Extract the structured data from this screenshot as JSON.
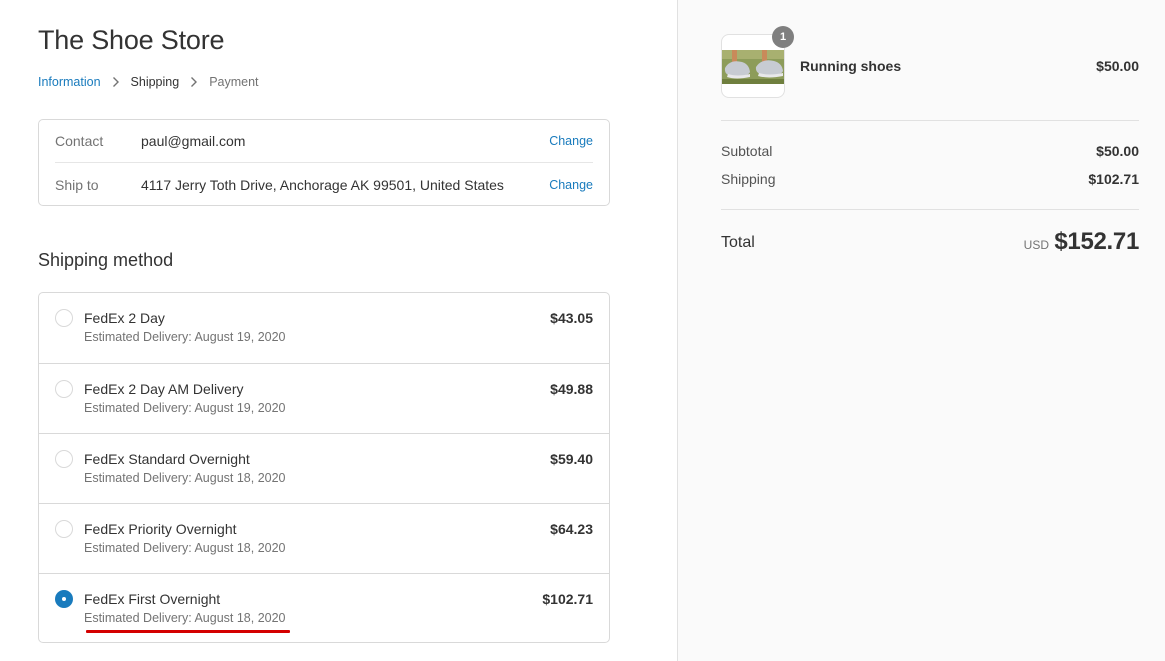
{
  "store": {
    "title": "The Shoe Store"
  },
  "breadcrumb": {
    "items": [
      {
        "label": "Information"
      },
      {
        "label": "Shipping"
      },
      {
        "label": "Payment"
      }
    ]
  },
  "review": {
    "contact": {
      "label": "Contact",
      "value": "paul@gmail.com",
      "change": "Change"
    },
    "ship_to": {
      "label": "Ship to",
      "value": "4117 Jerry Toth Drive, Anchorage AK 99501, United States",
      "change": "Change"
    }
  },
  "shipping": {
    "title": "Shipping method",
    "selected_index": 4,
    "methods": [
      {
        "name": "FedEx 2 Day",
        "eta": "Estimated Delivery: August 19, 2020",
        "price": "$43.05"
      },
      {
        "name": "FedEx 2 Day AM Delivery",
        "eta": "Estimated Delivery: August 19, 2020",
        "price": "$49.88"
      },
      {
        "name": "FedEx Standard Overnight",
        "eta": "Estimated Delivery: August 18, 2020",
        "price": "$59.40"
      },
      {
        "name": "FedEx Priority Overnight",
        "eta": "Estimated Delivery: August 18, 2020",
        "price": "$64.23"
      },
      {
        "name": "FedEx First Overnight",
        "eta": "Estimated Delivery: August 18, 2020",
        "price": "$102.71"
      }
    ]
  },
  "summary": {
    "item": {
      "name": "Running shoes",
      "price": "$50.00",
      "quantity": "1",
      "thumbnail_icon": "running-shoes-image"
    },
    "subtotal": {
      "label": "Subtotal",
      "value": "$50.00"
    },
    "shipping": {
      "label": "Shipping",
      "value": "$102.71"
    },
    "total": {
      "label": "Total",
      "currency": "USD",
      "value": "$152.71"
    }
  },
  "colors": {
    "accent": "#197bbd",
    "highlight_underline": "#d40000",
    "sidebar_bg": "#fafafa",
    "border": "#d9d9d9"
  }
}
